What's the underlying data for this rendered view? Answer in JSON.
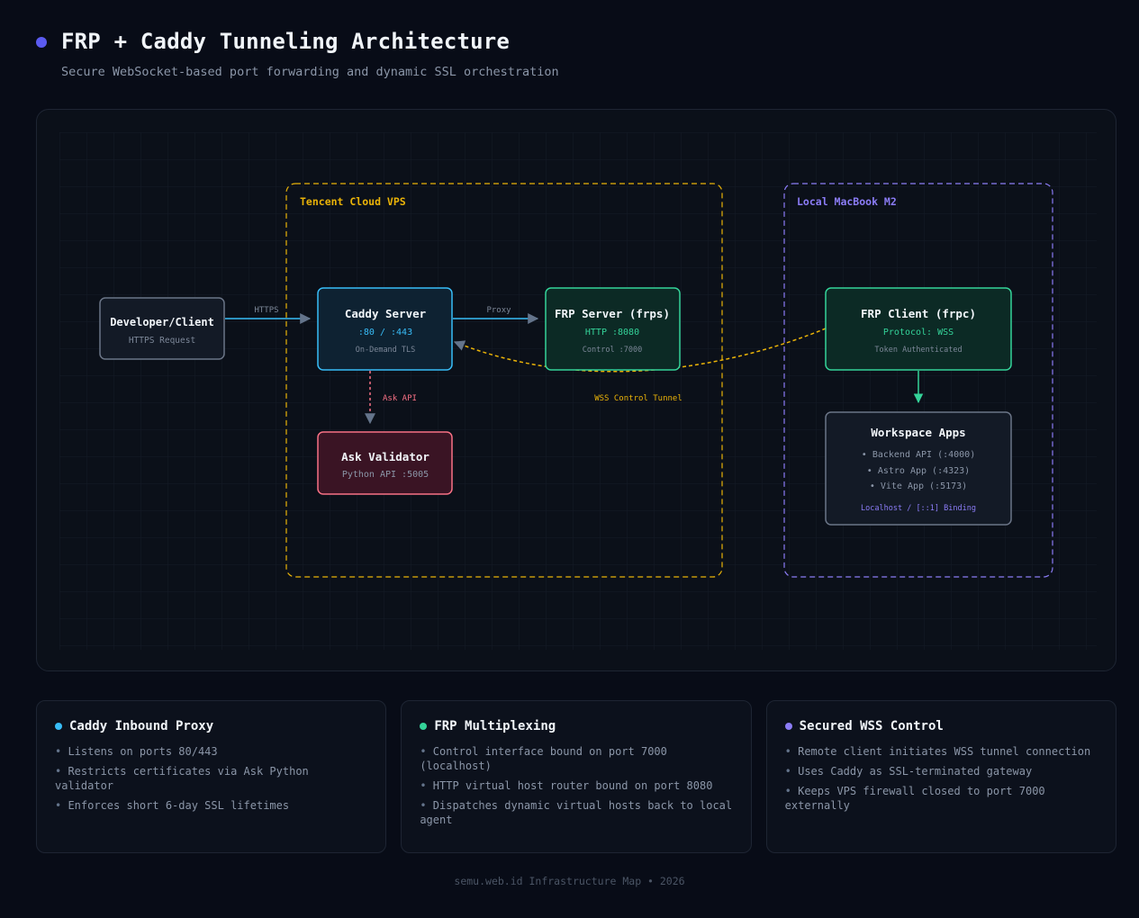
{
  "header": {
    "title": "FRP + Caddy Tunneling Architecture",
    "subtitle": "Secure WebSocket-based port forwarding and dynamic SSL orchestration"
  },
  "colors": {
    "background": "#080c17",
    "accent": "#5b5bf0",
    "caddy": "#38bdf8",
    "frp": "#34d399",
    "validator": "#f87185",
    "vps_zone": "#eab308",
    "local_zone": "#8b7cf6"
  },
  "diagram": {
    "zones": {
      "vps": "Tencent Cloud VPS",
      "local": "Local MacBook M2"
    },
    "nodes": {
      "client": {
        "title": "Developer/Client",
        "sub": "HTTPS Request"
      },
      "caddy": {
        "title": "Caddy Server",
        "ports": ":80 / :443",
        "sub": "On-Demand TLS"
      },
      "frps": {
        "title": "FRP Server (frps)",
        "ports": "HTTP :8080",
        "sub": "Control :7000"
      },
      "frpc": {
        "title": "FRP Client (frpc)",
        "ports": "Protocol: WSS",
        "sub": "Token Authenticated"
      },
      "validator": {
        "title": "Ask Validator",
        "sub": "Python API :5005"
      },
      "apps": {
        "title": "Workspace Apps",
        "items": [
          "• Backend API (:4000)",
          "• Astro App (:4323)",
          "• Vite App (:5173)"
        ],
        "binding": "Localhost / [::1] Binding"
      }
    },
    "edges": {
      "https": "HTTPS",
      "proxy": "Proxy",
      "ask_api": "Ask API",
      "wss_tunnel": "WSS Control Tunnel"
    }
  },
  "cards": [
    {
      "title": "Caddy Inbound Proxy",
      "color": "#38bdf8",
      "items": [
        "Listens on ports 80/443",
        "Restricts certificates via Ask Python validator",
        "Enforces short 6-day SSL lifetimes"
      ]
    },
    {
      "title": "FRP Multiplexing",
      "color": "#34d399",
      "items": [
        "Control interface bound on port 7000 (localhost)",
        "HTTP virtual host router bound on port 8080",
        "Dispatches dynamic virtual hosts back to local agent"
      ]
    },
    {
      "title": "Secured WSS Control",
      "color": "#8b7cf6",
      "items": [
        "Remote client initiates WSS tunnel connection",
        "Uses Caddy as SSL-terminated gateway",
        "Keeps VPS firewall closed to port 7000 externally"
      ]
    }
  ],
  "footer": "semu.web.id Infrastructure Map • 2026"
}
